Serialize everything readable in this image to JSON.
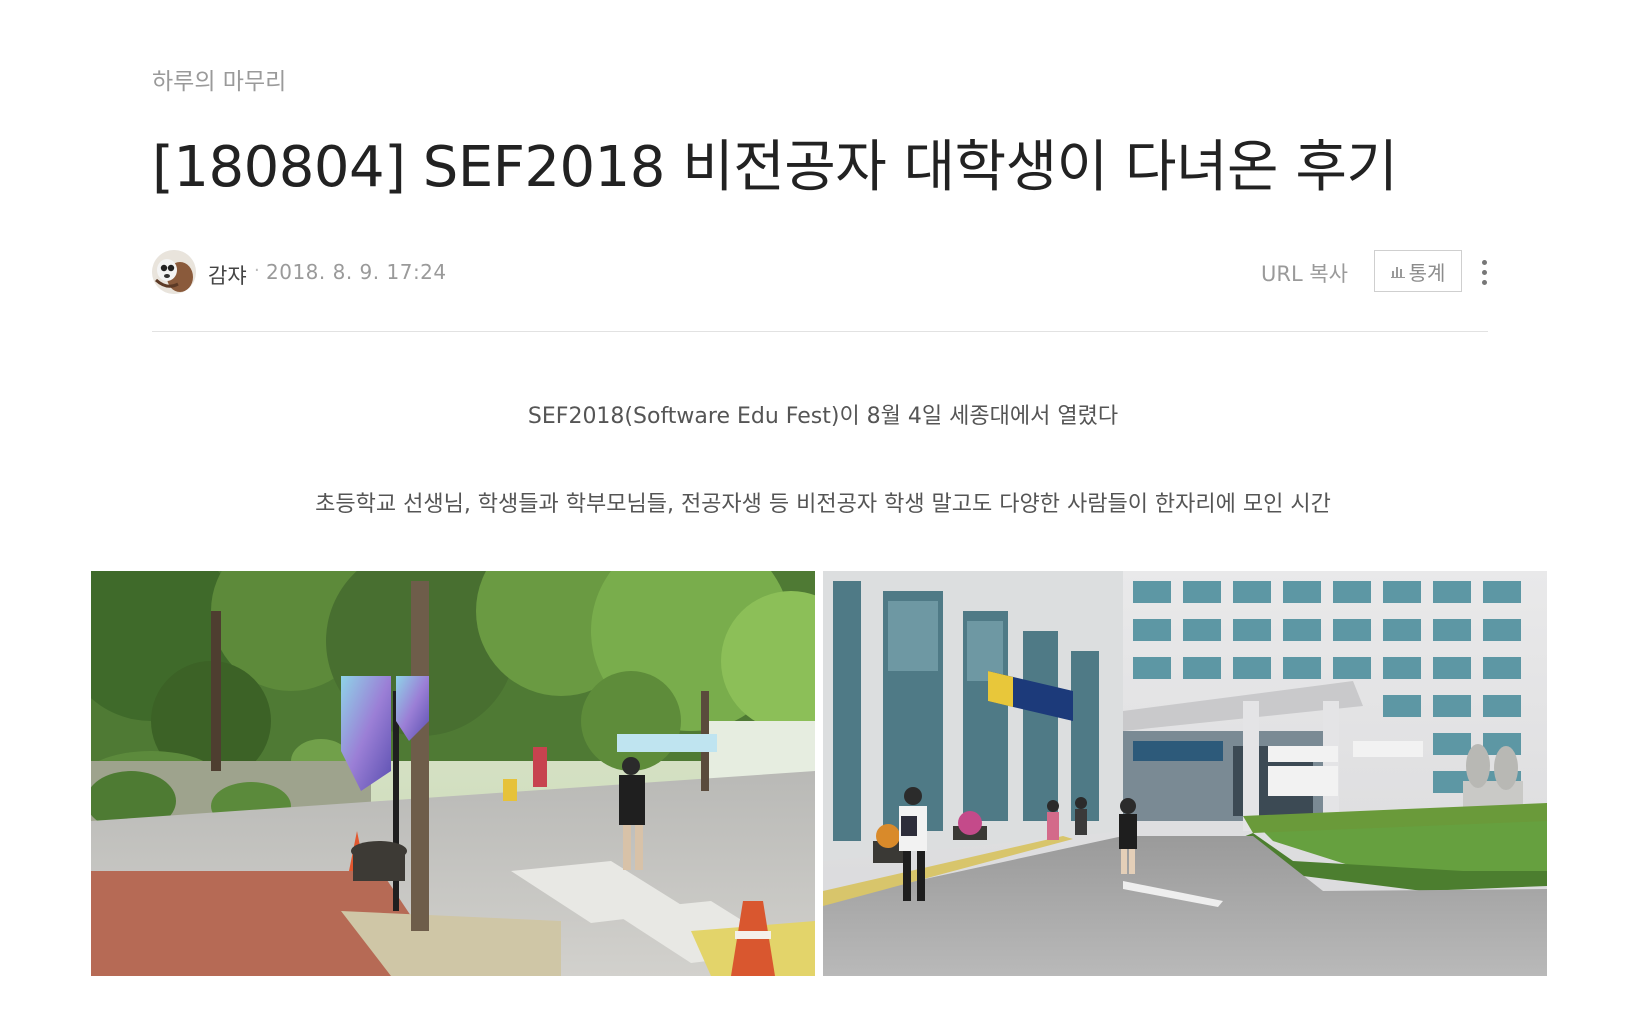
{
  "post": {
    "category": "하루의 마무리",
    "title": "[180804] SEF2018 비전공자 대학생이 다녀온 후기",
    "author": "감쟈",
    "separator": "·",
    "date": "2018. 8. 9. 17:24",
    "url_copy_label": "URL 복사",
    "stats_label": "통계",
    "icons": {
      "stats": "bar-chart-icon",
      "more": "more-vertical-icon",
      "avatar": "profile-avatar"
    }
  },
  "body": {
    "paragraph1": "SEF2018(Software Edu Fest)이 8월 4일 세종대에서 열렸다",
    "paragraph2": "초등학교 선생님, 학생들과 학부모님들, 전공자생 등 비전공자 학생 말고도 다양한 사람들이 한자리에 모인 시간"
  },
  "photos": {
    "left_alt": "캠퍼스 가로수길과 SOFTWARE EDU FEST 2018 배너",
    "right_alt": "세종대학교 건물 입구와 행사 현수막"
  },
  "colors": {
    "title": "#222222",
    "muted": "#9a9a9a",
    "body_text": "#555555",
    "divider": "#e2e2e2"
  }
}
